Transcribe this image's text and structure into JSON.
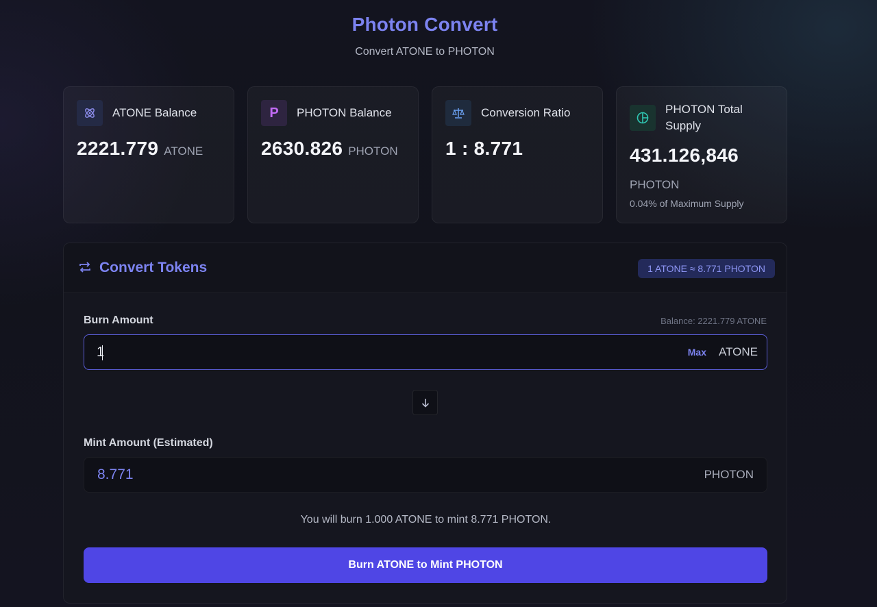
{
  "header": {
    "title": "Photon Convert",
    "subtitle": "Convert ATONE to PHOTON"
  },
  "cards": [
    {
      "label": "ATONE Balance",
      "value": "2221.779",
      "unit": "ATONE",
      "icon": "atom-icon"
    },
    {
      "label": "PHOTON Balance",
      "value": "2630.826",
      "unit": "PHOTON",
      "icon": "photon-p-icon",
      "icon_letter": "P"
    },
    {
      "label": "Conversion Ratio",
      "value": "1 : 8.771",
      "icon": "scale-icon"
    },
    {
      "label_line1": "PHOTON Total",
      "label_line2": "Supply",
      "value": "431.126,846",
      "unit": "PHOTON",
      "note": "0.04% of Maximum Supply",
      "icon": "pie-chart-icon"
    }
  ],
  "convert": {
    "title": "Convert Tokens",
    "rate_badge": "1 ATONE ≈ 8.771 PHOTON",
    "burn_label": "Burn Amount",
    "balance_note": "Balance: 2221.779 ATONE",
    "burn_value": "1",
    "max_label": "Max",
    "burn_token": "ATONE",
    "mint_label": "Mint Amount (Estimated)",
    "mint_value": "8.771",
    "mint_token": "PHOTON",
    "summary": "You will burn 1.000 ATONE to mint 8.771 PHOTON.",
    "submit_label": "Burn ATONE to Mint PHOTON"
  },
  "colors": {
    "accent": "#7c83f0",
    "button": "#4f46e5",
    "badge_bg": "#232a5a",
    "supply_icon": "#2fc7b3",
    "photon_icon": "#c26bf5",
    "scale_icon": "#6aa0f0"
  }
}
